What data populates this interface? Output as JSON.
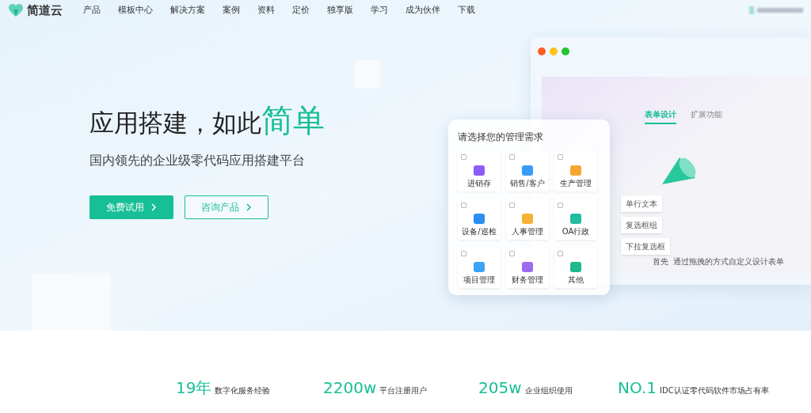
{
  "nav": {
    "brand": "简道云",
    "items": [
      "产品",
      "模板中心",
      "解决方案",
      "案例",
      "资料",
      "定价",
      "独享版",
      "学习",
      "成为伙伴",
      "下载"
    ]
  },
  "hero": {
    "title": "应用搭建，如此",
    "title_highlight": "简单",
    "subtitle": "国内领先的企业级零代码应用搭建平台",
    "buttons": [
      {
        "label": "免费试用",
        "kind": "primary"
      },
      {
        "label": "咨询产品",
        "kind": "outline"
      }
    ]
  },
  "needs_panel": {
    "title": "请选择您的管理需求",
    "options": [
      {
        "label": "进销存",
        "checked": false,
        "color": "#8b5cf6"
      },
      {
        "label": "销售/客户",
        "checked": false,
        "color": "#3b9cf6"
      },
      {
        "label": "生产管理",
        "checked": false,
        "color": "#f7a533"
      },
      {
        "label": "设备/巡检",
        "checked": false,
        "color": "#2b8ef0"
      },
      {
        "label": "人事管理",
        "checked": false,
        "color": "#f7b233"
      },
      {
        "label": "OA行政",
        "checked": false,
        "color": "#1fbf9c"
      },
      {
        "label": "项目管理",
        "checked": false,
        "color": "#3ba4f6"
      },
      {
        "label": "财务管理",
        "checked": false,
        "color": "#9b6cf0"
      },
      {
        "label": "其他",
        "checked": false,
        "color": "#1fb88f"
      }
    ]
  },
  "mockup": {
    "tabs": [
      {
        "label": "表单设计",
        "selected": true
      },
      {
        "label": "扩展功能",
        "selected": false
      }
    ],
    "fields": [
      "单行文本",
      "复选框组",
      "下拉复选框"
    ],
    "caption": "首先  通过拖拽的方式自定义设计表单"
  },
  "stats": [
    {
      "value": "19年",
      "label": "数字化服务经验"
    },
    {
      "value": "2200w",
      "label": "平台注册用户"
    },
    {
      "value": "205w",
      "label": "企业组织使用"
    },
    {
      "value": "NO.1",
      "label": "IDC认证零代码软件市场占有率"
    }
  ]
}
